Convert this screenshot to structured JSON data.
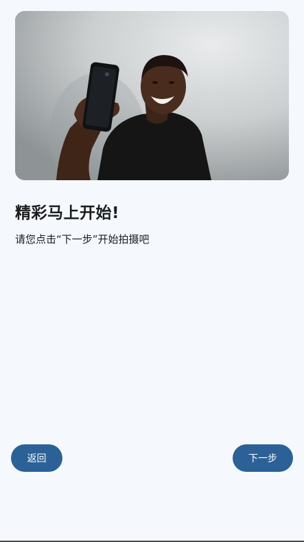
{
  "hero": {
    "image_description": "Smiling man taking a selfie with a smartphone"
  },
  "content": {
    "title": "精彩马上开始!",
    "subtitle": "请您点击“下一步”开始拍摄吧"
  },
  "buttons": {
    "back_label": "返回",
    "next_label": "下一步"
  },
  "colors": {
    "background": "#f5f9fd",
    "primary_button": "#2c6197",
    "button_text": "#ffffff",
    "text": "#1b1c1e"
  }
}
